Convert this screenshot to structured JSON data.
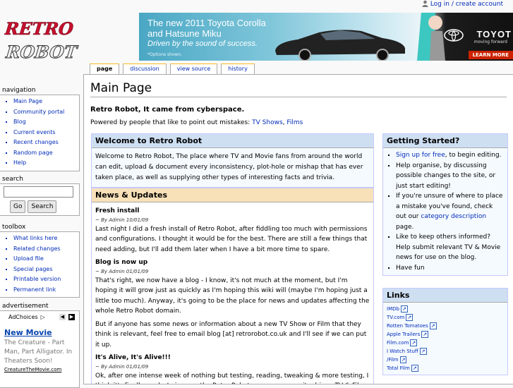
{
  "personal": {
    "login": "Log in / create account"
  },
  "logo": {
    "line1": "RETRO",
    "line2": "ROBOT"
  },
  "banner": {
    "title": "The new 2011 Toyota Corolla and Hatsune Miku",
    "tagline": "Driven by the sound of success.",
    "note": "*Options shown.",
    "brand": "TOYOT",
    "brand_sub": "moving forward",
    "learn": "LEARN MORE"
  },
  "tabs": [
    "page",
    "discussion",
    "view source",
    "history"
  ],
  "page": {
    "title": "Main Page",
    "tagline": "Retro Robot, It came from cyberspace.",
    "powered_prefix": "Powered by people that like to point out mistakes: ",
    "powered_link1": "TV Shows",
    "powered_sep": ", ",
    "powered_link2": "Films"
  },
  "welcome": {
    "title": "Welcome to Retro Robot",
    "text": "Welcome to Retro Robot, The place where TV and Movie fans from around the world can edit, upload & document every inconsistency, plot-hole or mishap that has ever taken place, as well as supplying other types of interesting facts and trivia."
  },
  "news": {
    "title": "News & Updates",
    "posts": [
      {
        "title": "Fresh install",
        "meta": "~ By Admin 10/01/09",
        "text": "Last night I did a fresh install of Retro Robot, after fiddling too much with permissions and configurations. I thought it would be for the best. There are still a few things that need adding, but I'll add them later when I have a bit more time to spare."
      },
      {
        "title": "Blog is now up",
        "meta": "~ By Admin 01/01/09",
        "text": "That's right, we now have a blog - I know, it's not much at the moment, but I'm hoping it will grow just as quickly as I'm hoping this wiki will (maybe I'm hoping just a little too much). Anyway, it's going to be the place for news and updates affecting the whole Retro Robot domain.",
        "text2": "But if anyone has some news or information about a new TV Show or Film that they think is relevant, feel free to email blog [at] retrorobot.co.uk and I'll see if we can put it up."
      },
      {
        "title": "It's Alive, It's Alive!!!",
        "meta": "~ By Admin 01/01/09",
        "text": "Ok, after one intense week of nothing but testing, reading, tweaking & more testing, I think it's finally ready. I give you the Retro Robot, a new community driven TV & Film wiki"
      }
    ]
  },
  "getting_started": {
    "title": "Getting Started?",
    "item1_link": "Sign up for free",
    "item1_rest": ", to begin editing.",
    "item2": "Help organise, by discussing possible changes to the site, or just start editing!",
    "item3_pre": "If you're unsure of where to place a mistake you've found, check out our ",
    "item3_link": "category description",
    "item3_post": " page.",
    "item4": "Like to keep others informed? Help submit relevant TV & Movie news for use on the blog.",
    "item5": "Have fun"
  },
  "links": {
    "title": "Links",
    "items": [
      "IMDb",
      "TV.com",
      "Rotten Tomatoes",
      "Apple Trailers",
      "Film.com",
      "I Watch Stuff",
      "/Film",
      "Total Film"
    ]
  },
  "sidebar": {
    "navigation": {
      "heading": "navigation",
      "items": [
        "Main Page",
        "Community portal",
        "Blog",
        "Current events",
        "Recent changes",
        "Random page",
        "Help"
      ]
    },
    "search": {
      "heading": "search",
      "go": "Go",
      "search": "Search"
    },
    "toolbox": {
      "heading": "toolbox",
      "items": [
        "What links here",
        "Related changes",
        "Upload file",
        "Special pages",
        "Printable version",
        "Permanent link"
      ]
    },
    "advertisement": {
      "heading": "advertisement",
      "adchoices": "AdChoices",
      "ad_title": "New Movie",
      "ad_text": "The Creature - Part Man, Part Alligator. In Theaters Soon!",
      "ad_url": "CreatureTheMovie.com"
    }
  },
  "colors": {
    "link": "#002bb8",
    "welcome_head": "#cedff2",
    "news_head": "#f8e0b9",
    "logo_red": "#c8102e"
  }
}
